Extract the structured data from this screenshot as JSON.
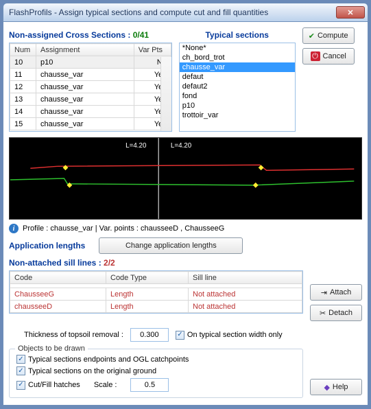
{
  "window": {
    "title": "FlashProfils - Assign typical sections and compute cut and fill quantities",
    "close_label": "✕"
  },
  "cross_sections": {
    "title_prefix": "Non-assigned Cross Sections :",
    "count": "0/41",
    "columns": {
      "num": "Num",
      "assignment": "Assignment",
      "varpts": "Var Pts"
    },
    "rows": [
      {
        "num": "10",
        "assignment": "p10",
        "varpts": "No",
        "hl": true
      },
      {
        "num": "11",
        "assignment": "chausse_var",
        "varpts": "Yes"
      },
      {
        "num": "12",
        "assignment": "chausse_var",
        "varpts": "Yes"
      },
      {
        "num": "13",
        "assignment": "chausse_var",
        "varpts": "Yes"
      },
      {
        "num": "14",
        "assignment": "chausse_var",
        "varpts": "Yes"
      },
      {
        "num": "15",
        "assignment": "chausse_var",
        "varpts": "Yes"
      }
    ]
  },
  "typical_sections": {
    "title": "Typical sections",
    "items": [
      {
        "label": "*None*"
      },
      {
        "label": "ch_bord_trot"
      },
      {
        "label": "chausse_var",
        "selected": true
      },
      {
        "label": "defaut"
      },
      {
        "label": "defaut2"
      },
      {
        "label": "fond"
      },
      {
        "label": "p10"
      },
      {
        "label": "trottoir_var"
      }
    ]
  },
  "actions": {
    "compute": "Compute",
    "cancel": "Cancel",
    "attach": "Attach",
    "detach": "Detach",
    "help": "Help",
    "change_app_len": "Change application lengths"
  },
  "profile": {
    "left_label": "L=4.20",
    "right_label": "L=4.20",
    "info": "Profile : chausse_var | Var. points : chausseeD , ChausseeG"
  },
  "app_lengths": {
    "title": "Application lengths"
  },
  "sill": {
    "title_prefix": "Non-attached sill lines :",
    "count": "2/2",
    "columns": {
      "code": "Code",
      "codetype": "Code Type",
      "sillline": "Sill line"
    },
    "rows": [
      {
        "code": "ChausseeG",
        "type": "Length",
        "sill": "Not attached"
      },
      {
        "code": "chausseeD",
        "type": "Length",
        "sill": "Not attached"
      }
    ]
  },
  "topsoil": {
    "label": "Thickness of topsoil removal :",
    "value": "0.300",
    "width_only": "On typical section width only"
  },
  "draw": {
    "legend": "Objects to be drawn",
    "endpoints": "Typical sections endpoints and OGL catchpoints",
    "original_ground": "Typical sections on the original ground",
    "hatches": "Cut/Fill hatches",
    "scale_label": "Scale :",
    "scale_value": "0.5"
  }
}
